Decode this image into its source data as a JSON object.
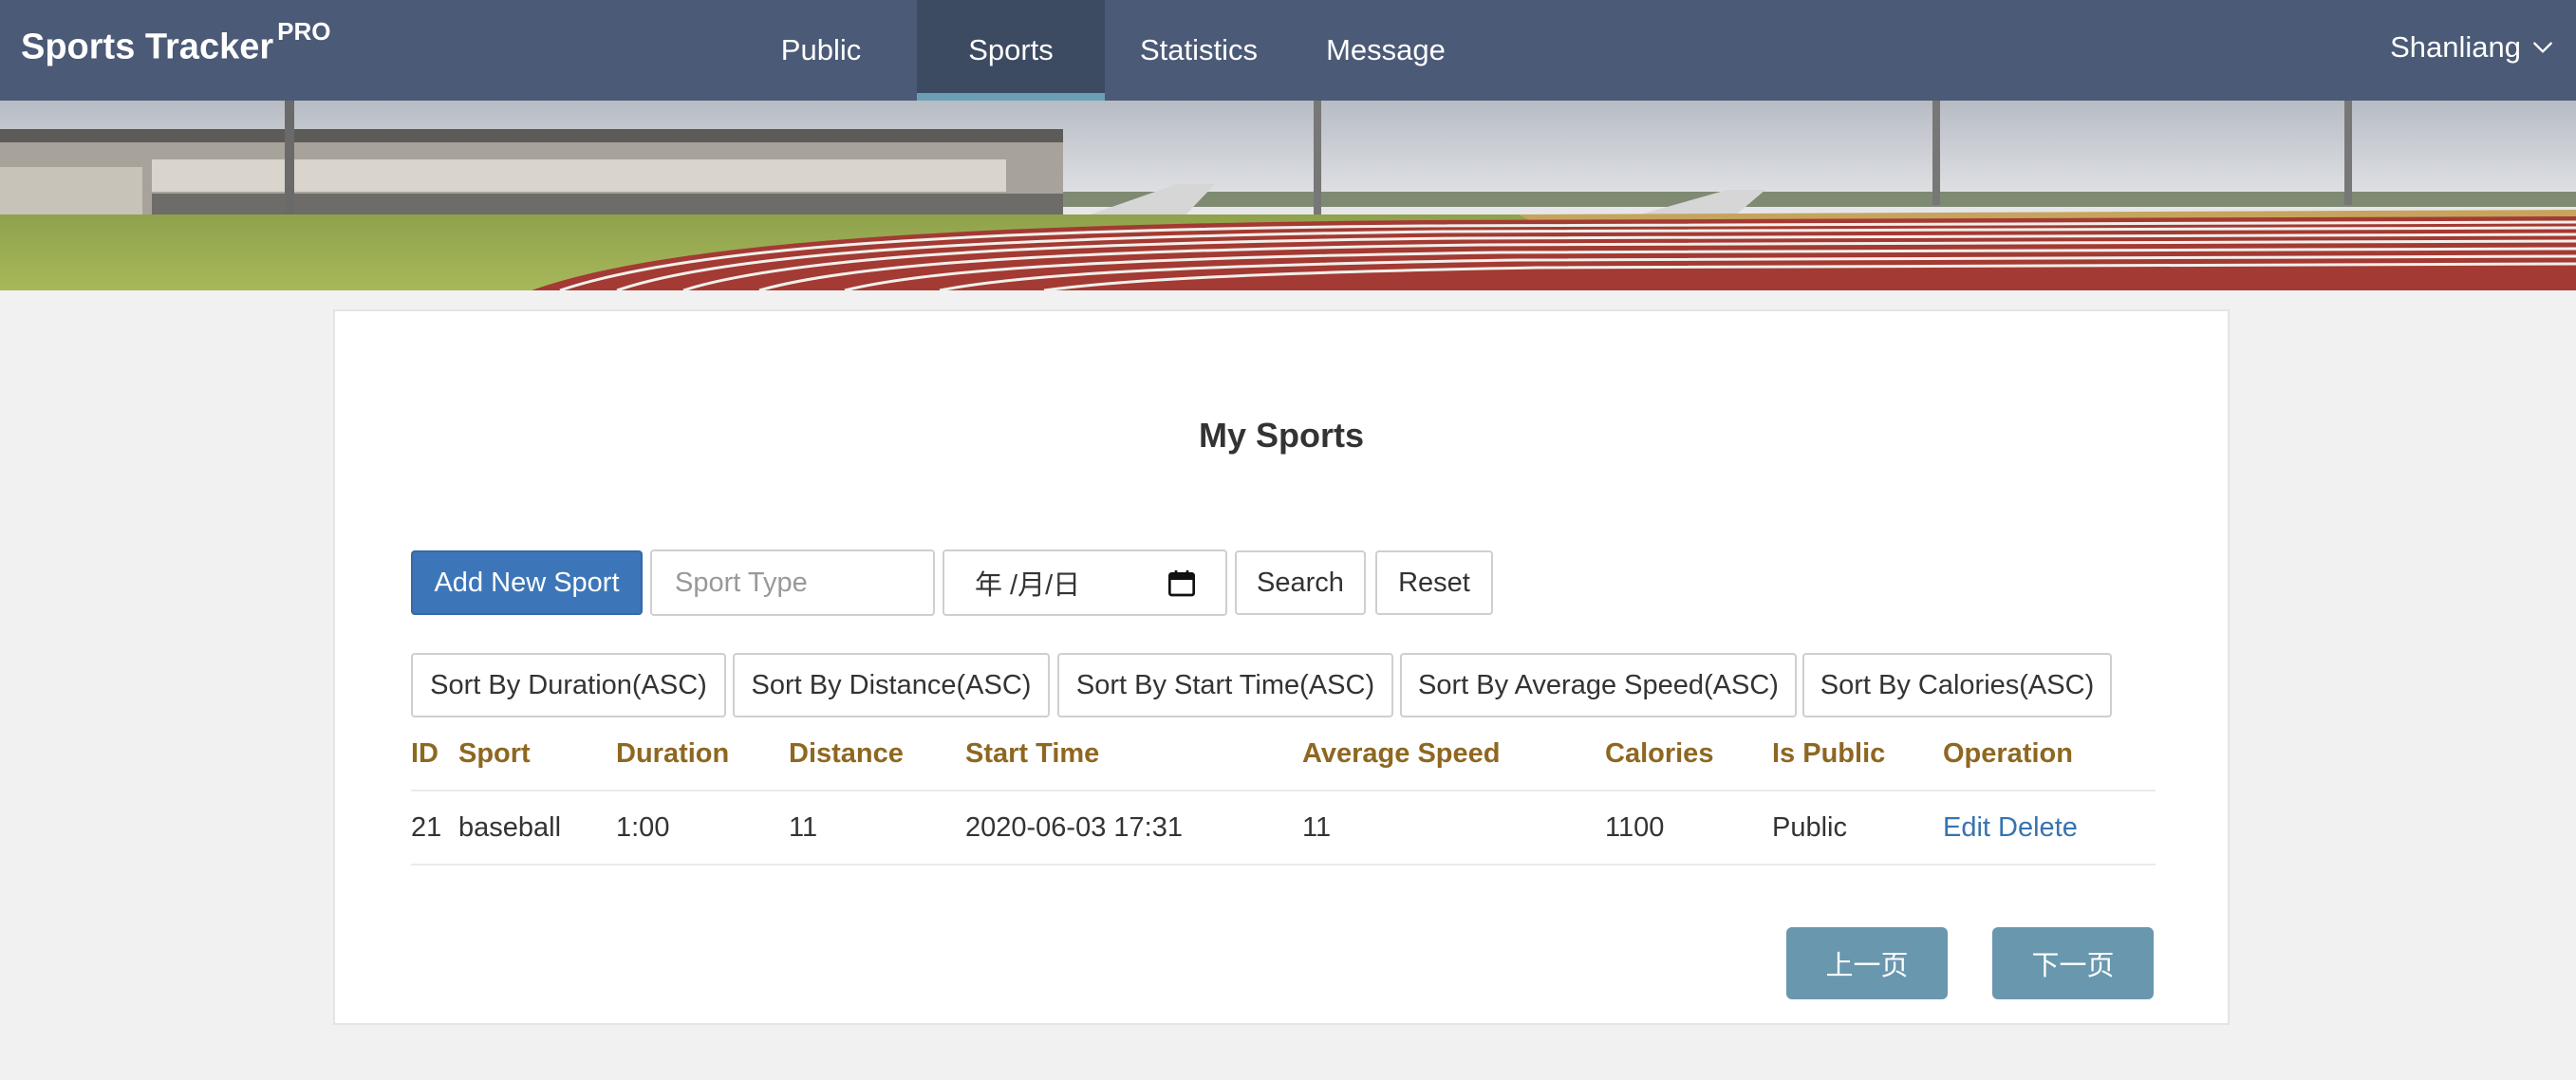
{
  "navbar": {
    "brand": "Sports Tracker",
    "brand_badge": "PRO",
    "items": [
      {
        "label": "Public"
      },
      {
        "label": "Sports"
      },
      {
        "label": "Statistics"
      },
      {
        "label": "Message"
      }
    ],
    "active": "Sports",
    "user": "Shanliang",
    "user_icon": "chevron-down-icon"
  },
  "main": {
    "title": "My Sports",
    "toolbar": {
      "add_label": "Add New Sport",
      "sport_type_placeholder": "Sport Type",
      "date_placeholder": "年 /月/日",
      "date_icon": "calendar-icon",
      "search_label": "Search",
      "reset_label": "Reset"
    },
    "sort_buttons": [
      "Sort By Duration(ASC)",
      "Sort By Distance(ASC)",
      "Sort By Start Time(ASC)",
      "Sort By Average Speed(ASC)",
      "Sort By Calories(ASC)"
    ],
    "table": {
      "columns": [
        "ID",
        "Sport",
        "Duration",
        "Distance",
        "Start Time",
        "Average Speed",
        "Calories",
        "Is Public",
        "Operation"
      ],
      "rows": [
        {
          "id": "21",
          "sport": "baseball",
          "duration": "1:00",
          "distance": "11",
          "start_time": "2020-06-03 17:31",
          "average_speed": "11",
          "calories": "1100",
          "is_public": "Public",
          "edit_label": "Edit",
          "delete_label": "Delete"
        }
      ]
    },
    "pager": {
      "prev_label": "上一页",
      "next_label": "下一页"
    }
  },
  "colors": {
    "navbar": "#4b5a76",
    "nav_active": "#3c4a62",
    "nav_active_underline": "#6b9fb6",
    "primary_button": "#3d76b8",
    "pager_button": "#6997ad",
    "table_header": "#8e6720",
    "link": "#3773b0"
  }
}
